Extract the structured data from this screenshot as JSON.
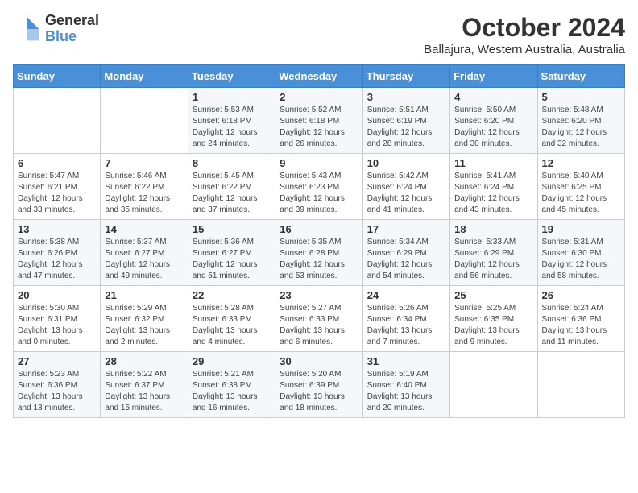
{
  "header": {
    "logo_general": "General",
    "logo_blue": "Blue",
    "month_title": "October 2024",
    "location": "Ballajura, Western Australia, Australia"
  },
  "days_of_week": [
    "Sunday",
    "Monday",
    "Tuesday",
    "Wednesday",
    "Thursday",
    "Friday",
    "Saturday"
  ],
  "weeks": [
    [
      {
        "day": "",
        "info": ""
      },
      {
        "day": "",
        "info": ""
      },
      {
        "day": "1",
        "info": "Sunrise: 5:53 AM\nSunset: 6:18 PM\nDaylight: 12 hours and 24 minutes."
      },
      {
        "day": "2",
        "info": "Sunrise: 5:52 AM\nSunset: 6:18 PM\nDaylight: 12 hours and 26 minutes."
      },
      {
        "day": "3",
        "info": "Sunrise: 5:51 AM\nSunset: 6:19 PM\nDaylight: 12 hours and 28 minutes."
      },
      {
        "day": "4",
        "info": "Sunrise: 5:50 AM\nSunset: 6:20 PM\nDaylight: 12 hours and 30 minutes."
      },
      {
        "day": "5",
        "info": "Sunrise: 5:48 AM\nSunset: 6:20 PM\nDaylight: 12 hours and 32 minutes."
      }
    ],
    [
      {
        "day": "6",
        "info": "Sunrise: 5:47 AM\nSunset: 6:21 PM\nDaylight: 12 hours and 33 minutes."
      },
      {
        "day": "7",
        "info": "Sunrise: 5:46 AM\nSunset: 6:22 PM\nDaylight: 12 hours and 35 minutes."
      },
      {
        "day": "8",
        "info": "Sunrise: 5:45 AM\nSunset: 6:22 PM\nDaylight: 12 hours and 37 minutes."
      },
      {
        "day": "9",
        "info": "Sunrise: 5:43 AM\nSunset: 6:23 PM\nDaylight: 12 hours and 39 minutes."
      },
      {
        "day": "10",
        "info": "Sunrise: 5:42 AM\nSunset: 6:24 PM\nDaylight: 12 hours and 41 minutes."
      },
      {
        "day": "11",
        "info": "Sunrise: 5:41 AM\nSunset: 6:24 PM\nDaylight: 12 hours and 43 minutes."
      },
      {
        "day": "12",
        "info": "Sunrise: 5:40 AM\nSunset: 6:25 PM\nDaylight: 12 hours and 45 minutes."
      }
    ],
    [
      {
        "day": "13",
        "info": "Sunrise: 5:38 AM\nSunset: 6:26 PM\nDaylight: 12 hours and 47 minutes."
      },
      {
        "day": "14",
        "info": "Sunrise: 5:37 AM\nSunset: 6:27 PM\nDaylight: 12 hours and 49 minutes."
      },
      {
        "day": "15",
        "info": "Sunrise: 5:36 AM\nSunset: 6:27 PM\nDaylight: 12 hours and 51 minutes."
      },
      {
        "day": "16",
        "info": "Sunrise: 5:35 AM\nSunset: 6:28 PM\nDaylight: 12 hours and 53 minutes."
      },
      {
        "day": "17",
        "info": "Sunrise: 5:34 AM\nSunset: 6:29 PM\nDaylight: 12 hours and 54 minutes."
      },
      {
        "day": "18",
        "info": "Sunrise: 5:33 AM\nSunset: 6:29 PM\nDaylight: 12 hours and 56 minutes."
      },
      {
        "day": "19",
        "info": "Sunrise: 5:31 AM\nSunset: 6:30 PM\nDaylight: 12 hours and 58 minutes."
      }
    ],
    [
      {
        "day": "20",
        "info": "Sunrise: 5:30 AM\nSunset: 6:31 PM\nDaylight: 13 hours and 0 minutes."
      },
      {
        "day": "21",
        "info": "Sunrise: 5:29 AM\nSunset: 6:32 PM\nDaylight: 13 hours and 2 minutes."
      },
      {
        "day": "22",
        "info": "Sunrise: 5:28 AM\nSunset: 6:33 PM\nDaylight: 13 hours and 4 minutes."
      },
      {
        "day": "23",
        "info": "Sunrise: 5:27 AM\nSunset: 6:33 PM\nDaylight: 13 hours and 6 minutes."
      },
      {
        "day": "24",
        "info": "Sunrise: 5:26 AM\nSunset: 6:34 PM\nDaylight: 13 hours and 7 minutes."
      },
      {
        "day": "25",
        "info": "Sunrise: 5:25 AM\nSunset: 6:35 PM\nDaylight: 13 hours and 9 minutes."
      },
      {
        "day": "26",
        "info": "Sunrise: 5:24 AM\nSunset: 6:36 PM\nDaylight: 13 hours and 11 minutes."
      }
    ],
    [
      {
        "day": "27",
        "info": "Sunrise: 5:23 AM\nSunset: 6:36 PM\nDaylight: 13 hours and 13 minutes."
      },
      {
        "day": "28",
        "info": "Sunrise: 5:22 AM\nSunset: 6:37 PM\nDaylight: 13 hours and 15 minutes."
      },
      {
        "day": "29",
        "info": "Sunrise: 5:21 AM\nSunset: 6:38 PM\nDaylight: 13 hours and 16 minutes."
      },
      {
        "day": "30",
        "info": "Sunrise: 5:20 AM\nSunset: 6:39 PM\nDaylight: 13 hours and 18 minutes."
      },
      {
        "day": "31",
        "info": "Sunrise: 5:19 AM\nSunset: 6:40 PM\nDaylight: 13 hours and 20 minutes."
      },
      {
        "day": "",
        "info": ""
      },
      {
        "day": "",
        "info": ""
      }
    ]
  ]
}
